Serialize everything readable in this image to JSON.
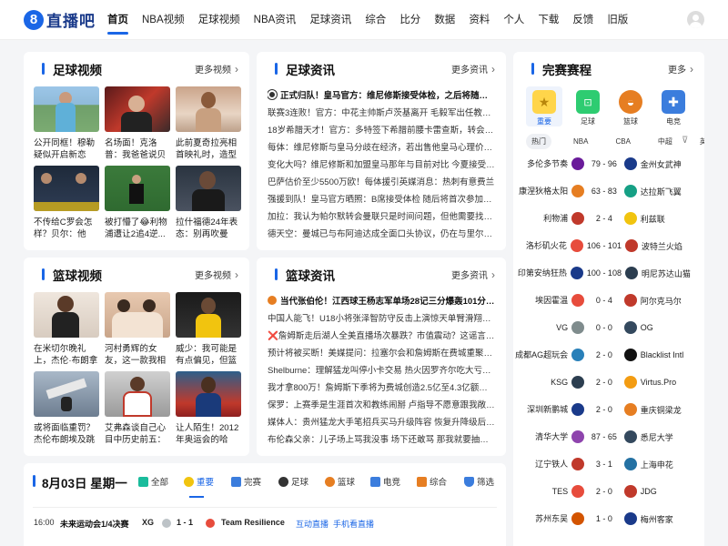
{
  "brand": {
    "logo_digit": "8",
    "logo_text": "直播吧",
    "accent": "#1a66e6"
  },
  "nav": [
    "首页",
    "NBA视频",
    "足球视频",
    "NBA资讯",
    "足球资讯",
    "综合",
    "比分",
    "数据",
    "资料",
    "个人",
    "下载",
    "反馈",
    "旧版"
  ],
  "football_video": {
    "title": "足球视频",
    "more": "更多视频",
    "items": [
      {
        "caption": "公开同框！穆勒疑似开启新恋情，..."
      },
      {
        "caption": "名场面！克洛普：我爸爸说贝利是..."
      },
      {
        "caption": "此前夏奇拉亮相首映礼时，造型师..."
      },
      {
        "caption": "不传给C罗会怎样？贝尔：他确..."
      },
      {
        "caption": "被打懵了😂利物浦遭让2追4逆..."
      },
      {
        "caption": "拉什福德24年表态：别再吹曼联..."
      }
    ]
  },
  "football_news": {
    "title": "足球资讯",
    "more": "更多资讯",
    "items": [
      "正式归队！皇马官方：维尼修斯接受体检，之后将随队季...",
      "联赛3连败！官方：中花主帅斯卢茨基离开 毛毅军出任教练组...",
      "18岁希腊天才！官方：多特签下希腊前腰卡雷查斯，转会费33...",
      "每体：维尼修斯与皇马分歧在经济，若出售他皇马心理价位1.7...",
      "变化大吗？维尼修斯和加盟皇马那年与目前对比 今夏接受整形...",
      "巴萨估价至少5500万欧！每体援引英媒消息：热刺有意费兰",
      "强援到队！皇马官方晒照：B席接受体检 随后将首次参加穆帅...",
      "加拉：我认为帕尔默转会曼联只是时间问题，但他需要找回跑...",
      "德天空：曼城已与布阿迪达成全面口头协议，仍在与里尔谈判"
    ]
  },
  "basketball_video": {
    "title": "篮球视频",
    "more": "更多视频",
    "items": [
      {
        "caption": "在米切尔晚礼上，杰伦·布朗拿手..."
      },
      {
        "caption": "河村勇辉的女友，这一款我相信没..."
      },
      {
        "caption": "威少：我可能是有点偏见，但篮球..."
      },
      {
        "caption": "或将面临重罚？杰伦布朗埃及跳伞..."
      },
      {
        "caption": "艾弗森谈自己心目中历史前五：乔..."
      },
      {
        "caption": "让人陌生！2012年奥运会的哈登..."
      }
    ]
  },
  "basketball_news": {
    "title": "篮球资讯",
    "more": "更多资讯",
    "items": [
      "当代张伯伦！江西球王杨志军单场28记三分爆轰101分上演...",
      "中国人能飞！U18小将张泽智防守反击上演惊天单臂滑翔扣！",
      "❌詹姆斯走后湖人全美直播场次暴跌？市值震动？这谣言太扯！",
      "预计将被买断！美媒提问：拉塞尔会和詹姆斯在费城重聚吗？",
      "Shelburne：理解猛龙叫停小卡交易 热火因罗齐尔吃大亏是前...",
      "我才拿800万！詹姆斯下季将为费城创造2.5亿至4.3亿额外经...",
      "保罗：上赛季是生涯首次和教练闹掰 卢指导不愿意跟我敞开了聊",
      "媒体人：贵州猛龙大手笔招兵买马升级阵容 恢复升降级后值得...",
      "布伦森父亲：儿子场上骂我没事 场下还敢骂 那我就要抽出皮..."
    ]
  },
  "schedule": {
    "title": "完赛赛程",
    "more": "更多",
    "categories": [
      {
        "label": "重要",
        "icon": "star-icon"
      },
      {
        "label": "足球",
        "icon": "football-pitch-icon"
      },
      {
        "label": "篮球",
        "icon": "basketball-hoop-icon"
      },
      {
        "label": "电竞",
        "icon": "gamepad-icon"
      }
    ],
    "tabs": [
      "热门",
      "NBA",
      "CBA",
      "中超",
      "英超"
    ],
    "matches": [
      {
        "home": "多伦多节奏",
        "score": "79 - 96",
        "away": "金州女武神"
      },
      {
        "home": "康涅狄格太阳",
        "score": "63 - 83",
        "away": "达拉斯飞翼"
      },
      {
        "home": "利物浦",
        "score": "2 - 4",
        "away": "利兹联"
      },
      {
        "home": "洛杉矶火花",
        "score": "106 - 101",
        "away": "波特兰火焰"
      },
      {
        "home": "印第安纳狂热",
        "score": "100 - 108",
        "away": "明尼苏达山猫"
      },
      {
        "home": "埃因霍温",
        "score": "0 - 4",
        "away": "阿尔克马尔"
      },
      {
        "home": "VG",
        "score": "0 - 0",
        "away": "OG"
      },
      {
        "home": "成都AG超玩会",
        "score": "2 - 0",
        "away": "Blacklist Intl"
      },
      {
        "home": "KSG",
        "score": "2 - 0",
        "away": "Virtus.Pro"
      },
      {
        "home": "深圳新鹏城",
        "score": "2 - 0",
        "away": "重庆铜梁龙"
      },
      {
        "home": "清华大学",
        "score": "87 - 65",
        "away": "悉尼大学"
      },
      {
        "home": "辽宁铁人",
        "score": "3 - 1",
        "away": "上海申花"
      },
      {
        "home": "TES",
        "score": "2 - 0",
        "away": "JDG"
      },
      {
        "home": "苏州东吴",
        "score": "1 - 0",
        "away": "梅州客家"
      }
    ]
  },
  "dateline": {
    "date": "8月03日 星期一",
    "tabs": [
      "全部",
      "重要",
      "完赛",
      "足球",
      "篮球",
      "电竞",
      "综合",
      "筛选"
    ],
    "match": {
      "time": "16:00",
      "event": "未来运动会1/4决赛",
      "home": "XG",
      "score": "1 - 1",
      "away": "Team Resilience",
      "link1": "互动直播",
      "link2": "手机看直播"
    }
  }
}
